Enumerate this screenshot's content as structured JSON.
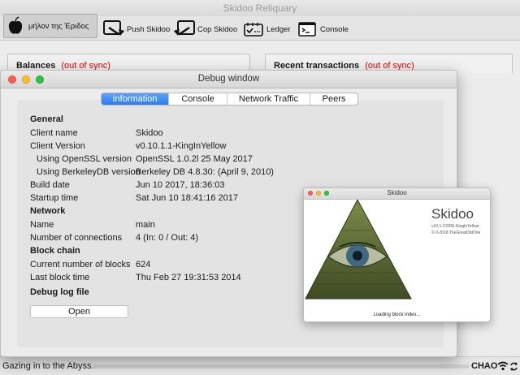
{
  "main_window": {
    "title": "Skidoo Reliquary",
    "toolbar": {
      "overview_label": "μήλον της Έριδος",
      "push_label": "Push Skidoo",
      "cop_label": "Cop Skidoo",
      "ledger_label": "Ledger",
      "console_label": "Console"
    },
    "balances": {
      "title": "Balances",
      "sync": "(out of sync)"
    },
    "recent": {
      "title": "Recent transactions",
      "sync": "(out of sync)"
    },
    "status": {
      "text": "Gazing in to the Abyss...",
      "unit": "CHAO",
      "progress": 0.0
    }
  },
  "debug_window": {
    "title": "Debug window",
    "tabs": [
      "Information",
      "Console",
      "Network Traffic",
      "Peers"
    ],
    "active_tab": "Information",
    "general": {
      "heading": "General",
      "client_name_label": "Client name",
      "client_name": "Skidoo",
      "client_version_label": "Client Version",
      "client_version": "v0.10.1.1-KingInYellow",
      "openssl_label": "Using OpenSSL version",
      "openssl": "OpenSSL 1.0.2l  25 May 2017",
      "berkeleydb_label": "Using BerkeleyDB version",
      "berkeleydb": "Berkeley DB 4.8.30: (April  9, 2010)",
      "build_date_label": "Build date",
      "build_date": "Jun 10 2017, 18:36:03",
      "startup_label": "Startup time",
      "startup": "Sat Jun 10 18:41:16 2017"
    },
    "network": {
      "heading": "Network",
      "name_label": "Name",
      "name": "main",
      "connections_label": "Number of connections",
      "connections": "4 (In: 0 / Out: 4)"
    },
    "blockchain": {
      "heading": "Block chain",
      "blocks_label": "Current number of blocks",
      "blocks": "624",
      "last_block_label": "Last block time",
      "last_block": "Thu Feb 27 19:31:53 2014"
    },
    "debug_log": {
      "heading": "Debug log file",
      "open_label": "Open"
    }
  },
  "splash_window": {
    "title": "Skidoo",
    "name": "Skidoo",
    "version": "v10.1-CORE-KingInYellow",
    "copyright": "© 0-2018 TheGreatOldOne",
    "loading": "Loading block index..."
  },
  "colors": {
    "out_of_sync": "#dd0000",
    "tab_active": "#2a7ef2",
    "pyramid": "#5a6a2e"
  },
  "icons": [
    "apple-icon",
    "push-arrow-icon",
    "cop-arrow-icon",
    "ledger-icon",
    "console-icon",
    "eye-pyramid-icon",
    "wifi-icon",
    "sync-icon"
  ]
}
